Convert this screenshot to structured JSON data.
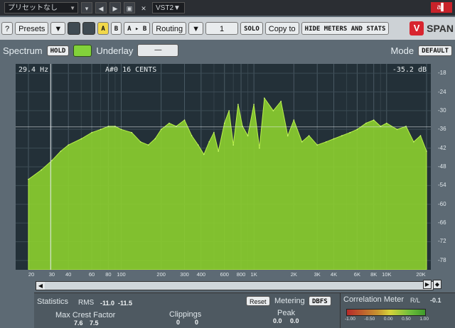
{
  "host": {
    "preset_name": "プリセットなし",
    "plugin_format": "VST2▼",
    "rec_label": "a▌"
  },
  "toolbar": {
    "help_label": "?",
    "presets_label": "Presets",
    "a_label": "A",
    "b_label": "B",
    "a_to_b_label": "A ▸ B",
    "routing_label": "Routing",
    "channel_value": "1",
    "solo_label": "SOLO",
    "copy_to_label": "Copy to",
    "hide_meters_label": "HIDE METERS AND STATS",
    "logo_text": "SPAN"
  },
  "spectrum": {
    "title": "Spectrum",
    "hold_label": "HOLD",
    "underlay_label": "Underlay",
    "underlay_value": "—",
    "mode_label": "Mode",
    "mode_value": "DEFAULT",
    "readout_freq": "29.4 Hz",
    "readout_note": "A#0  16 CENTS",
    "readout_level": "-35.2 dB"
  },
  "y_ticks": [
    "-18",
    "-24",
    "-30",
    "-36",
    "-42",
    "-48",
    "-54",
    "-60",
    "-66",
    "-72",
    "-78"
  ],
  "x_ticks": [
    "20",
    "30",
    "40",
    "60",
    "80",
    "100",
    "200",
    "300",
    "400",
    "600",
    "800",
    "1K",
    "2K",
    "3K",
    "4K",
    "6K",
    "8K",
    "10K",
    "20K"
  ],
  "chart_data": {
    "type": "area",
    "x": [
      20,
      25,
      30,
      35,
      40,
      50,
      60,
      70,
      80,
      90,
      100,
      120,
      140,
      160,
      180,
      200,
      230,
      260,
      300,
      340,
      380,
      420,
      460,
      500,
      540,
      600,
      650,
      700,
      760,
      820,
      900,
      1000,
      1100,
      1200,
      1400,
      1600,
      1800,
      2000,
      2300,
      2600,
      3000,
      3500,
      4000,
      4600,
      5300,
      6000,
      7000,
      8000,
      9000,
      10000,
      12000,
      14000,
      16000,
      18000,
      20000
    ],
    "values": [
      -52,
      -49,
      -46,
      -43,
      -41,
      -39,
      -37,
      -36,
      -35,
      -35,
      -36,
      -37,
      -40,
      -41,
      -39,
      -36,
      -34,
      -35,
      -33,
      -38,
      -41,
      -44,
      -40,
      -37,
      -43,
      -34,
      -30,
      -41,
      -28,
      -35,
      -38,
      -28,
      -42,
      -26,
      -30,
      -27,
      -38,
      -33,
      -40,
      -38,
      -41,
      -40,
      -39,
      -38,
      -37,
      -36,
      -34,
      -33,
      -35,
      -34,
      -36,
      -35,
      -40,
      -38,
      -43
    ],
    "xlim": [
      20,
      20000
    ],
    "ylim": [
      -81,
      -15
    ],
    "x_scale": "log",
    "fill_color": "#8ed42e",
    "grid": true
  },
  "stats": {
    "title": "Statistics",
    "rms_label": "RMS",
    "rms_l": "-11.0",
    "rms_r": "-11.5",
    "reset_label": "Reset",
    "metering_label": "Metering",
    "metering_value": "DBFS",
    "max_crest_label": "Max Crest Factor",
    "crest_l": "7.6",
    "crest_r": "7.5",
    "clippings_label": "Clippings",
    "clip_l": "0",
    "clip_r": "0",
    "peak_label": "Peak",
    "peak_l": "0.0",
    "peak_r": "0.0"
  },
  "correlation": {
    "title": "Correlation Meter",
    "channels": "R/L",
    "value": "-0.1",
    "ticks": [
      "-1.00",
      "-0.50",
      "0.00",
      "0.50",
      "1.00"
    ]
  }
}
